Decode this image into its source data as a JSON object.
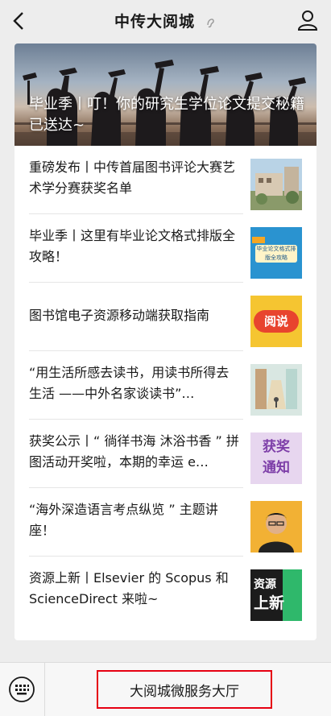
{
  "header": {
    "title": "中传大阅城"
  },
  "hero": {
    "title": "毕业季丨叮！你的研究生学位论文提交秘籍已送达~"
  },
  "articles": [
    {
      "title": "重磅发布丨中传首届图书评论大赛艺术学分赛获奖名单",
      "thumb": "campus-photo"
    },
    {
      "title": "毕业季丨这里有毕业论文格式排版全攻略！",
      "thumb": "format-guide",
      "thumb_text": "毕业论文格式排版全攻略"
    },
    {
      "title": "图书馆电子资源移动端获取指南",
      "thumb": "read-badge",
      "thumb_text": "阅说"
    },
    {
      "title": "“用生活所感去读书，用读书所得去生活 ——中外名家谈读书”…",
      "thumb": "book-illustration"
    },
    {
      "title": "获奖公示丨“ 徜徉书海 沐浴书香 ” 拼图活动开奖啦，本期的幸运 e…",
      "thumb": "award-notice",
      "thumb_text1": "获奖",
      "thumb_text2": "通知"
    },
    {
      "title": "“海外深造语言考点纵览 ” 主题讲座！",
      "thumb": "speaker-photo"
    },
    {
      "title": "资源上新丨Elsevier 的 Scopus 和 ScienceDirect 来啦~",
      "thumb": "new-resource",
      "thumb_text1": "资源",
      "thumb_text2": "上新"
    }
  ],
  "bottom": {
    "menu_label": "大阅城微服务大厅"
  },
  "colors": {
    "accent_border": "#e60012",
    "background": "#ededed"
  }
}
